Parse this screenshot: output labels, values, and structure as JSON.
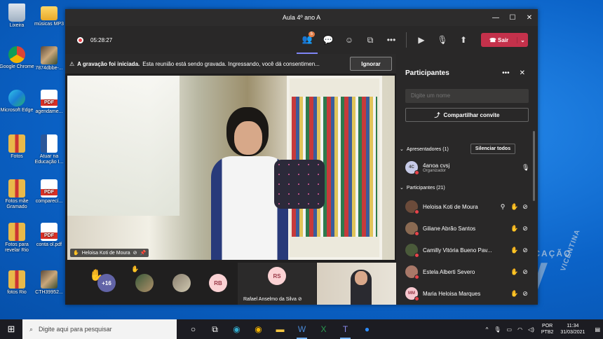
{
  "desktop": {
    "icons": [
      {
        "label": "Lixeira",
        "kind": "bin"
      },
      {
        "label": "músicas MP3",
        "kind": "folder"
      },
      {
        "label": "Google Chrome",
        "kind": "chrome"
      },
      {
        "label": "7874dbbe-...",
        "kind": "photo"
      },
      {
        "label": "Microsoft Edge",
        "kind": "edge"
      },
      {
        "label": "agendame...",
        "kind": "pdf"
      },
      {
        "label": "Fotos",
        "kind": "zip"
      },
      {
        "label": "Atuar na Educação I...",
        "kind": "word"
      },
      {
        "label": "Fotos mãe Gramado",
        "kind": "zip"
      },
      {
        "label": "comparecí...",
        "kind": "pdf"
      },
      {
        "label": "Fotos para revelar Rio",
        "kind": "zip"
      },
      {
        "label": "conta ol.pdf",
        "kind": "pdf"
      },
      {
        "label": "fotos Rio",
        "kind": "zip"
      },
      {
        "label": "CTH39952...",
        "kind": "photo"
      }
    ]
  },
  "window": {
    "title": "Aula 4º ano A",
    "controls": {
      "minimize": "—",
      "maximize": "☐",
      "close": "✕"
    }
  },
  "toolbar": {
    "timer": "05:28:27",
    "participants_badge": "5",
    "leave_label": "Sair"
  },
  "notice": {
    "title": "A gravação foi iniciada.",
    "text": "Esta reunião está sendo gravada. Ingressando, você dá consentimen...",
    "ignore_label": "Ignorar"
  },
  "video": {
    "speaker_label": "Heloisa Koti de Moura"
  },
  "strip": {
    "more_count": "+16",
    "avatar_rb": "RB",
    "tile_initials": "RS",
    "tile_name": "Rafael Anselmo da Silva"
  },
  "panel": {
    "title": "Participantes",
    "search_placeholder": "Digite um nome",
    "share_label": "Compartilhar convite",
    "presenters_header": "Apresentadores (1)",
    "mute_all_label": "Silenciar todos",
    "presenter": {
      "initials": "4C",
      "name": "4anoa cvsj",
      "role": "Organizador"
    },
    "participants_header": "Participantes (21)",
    "participants": [
      {
        "initials": "",
        "name": "Heloisa Koti de Moura",
        "color": "#6b4b3a",
        "icons": [
          "pin",
          "hand",
          "mic-off"
        ]
      },
      {
        "initials": "",
        "name": "Giliane Abrão Santos",
        "color": "#8a6a52",
        "icons": [
          "hand",
          "mic-off"
        ]
      },
      {
        "initials": "",
        "name": "Camilly Vitória Bueno Pav...",
        "color": "#4a5a3a",
        "icons": [
          "hand",
          "mic-off"
        ]
      },
      {
        "initials": "",
        "name": "Estela Alberti Severo",
        "color": "#a87868",
        "icons": [
          "hand",
          "mic-off"
        ]
      },
      {
        "initials": "MM",
        "name": "Maria Heloisa Marques",
        "color": "#f7c8cf",
        "icons": [
          "hand",
          "mic-off"
        ]
      }
    ]
  },
  "watermark": {
    "line1": "EDUCAÇÃO",
    "letter": "V",
    "line2": "VICENTINA"
  },
  "taskbar": {
    "search_placeholder": "Digite aqui para pesquisar",
    "lang1": "POR",
    "lang2": "PTB2",
    "time": "11:34",
    "date": "31/03/2021"
  }
}
